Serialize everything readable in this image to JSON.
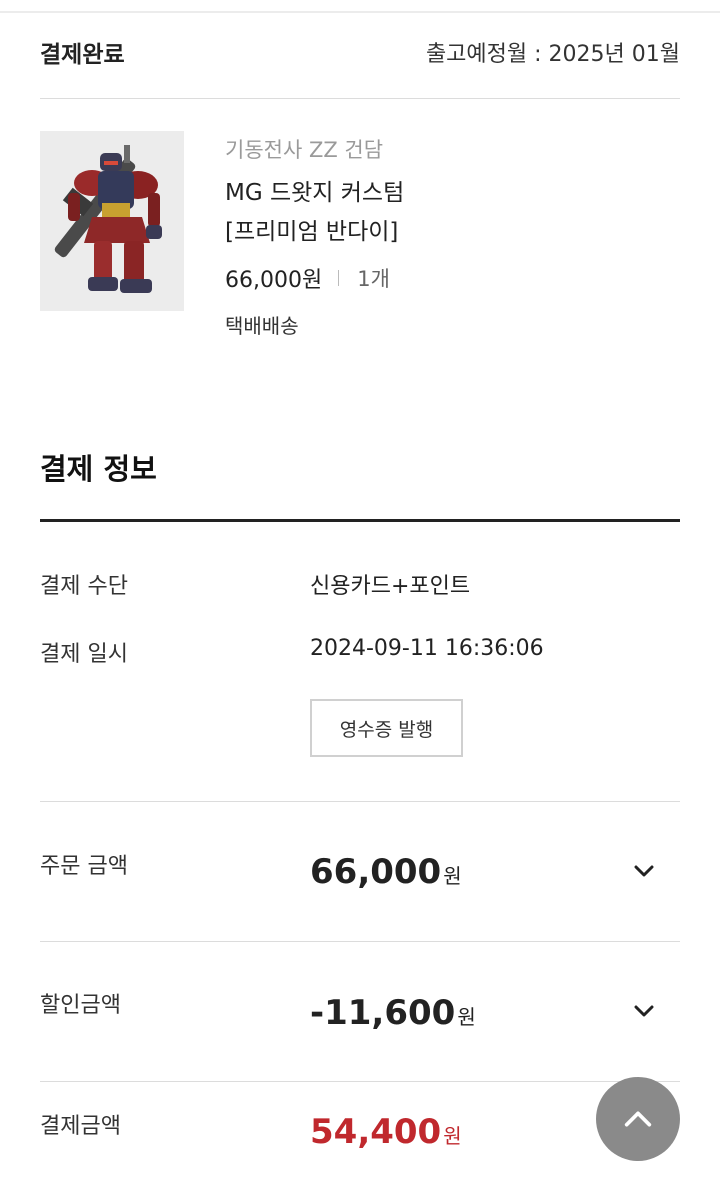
{
  "order": {
    "status": "결제완료",
    "ship_date": "출고예정월 : 2025년 01월"
  },
  "product": {
    "category": "기동전사 ZZ 건담",
    "name_line1": "MG 드왓지 커스텀",
    "name_line2": "[프리미엄 반다이]",
    "price": "66,000원",
    "quantity": "1개",
    "delivery": "택배배송",
    "image_icon": "gundam-model-image"
  },
  "payment": {
    "title": "결제 정보",
    "method_label": "결제 수단",
    "method_value": "신용카드+포인트",
    "date_label": "결제 일시",
    "date_value": "2024-09-11 16:36:06",
    "receipt_button": "영수증 발행"
  },
  "amounts": {
    "order": {
      "label": "주문 금액",
      "value": "66,000",
      "unit": "원"
    },
    "discount": {
      "label": "할인금액",
      "value": "-11,600",
      "unit": "원"
    },
    "total": {
      "label": "결제금액",
      "value": "54,400",
      "unit": "원"
    }
  },
  "colors": {
    "accent_red": "#c0282d",
    "fab": "#8a8a8a"
  },
  "icons": {
    "expand": "chevron-down-icon",
    "scroll_top": "chevron-up-icon"
  }
}
